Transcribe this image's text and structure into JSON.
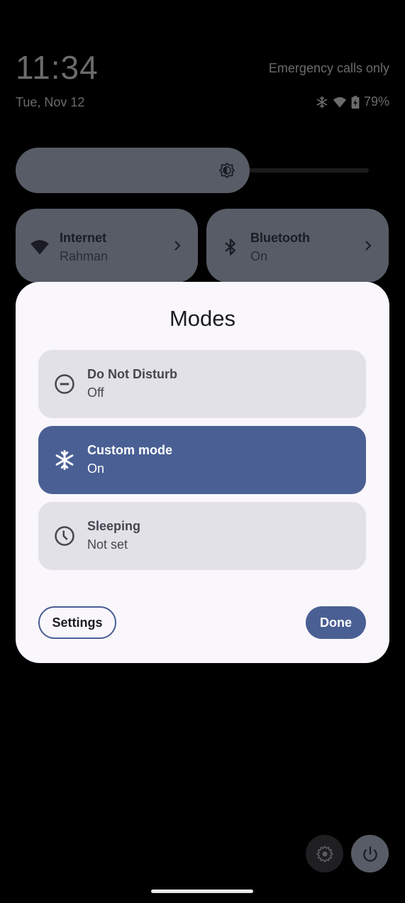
{
  "status_bar": {
    "time": "11:34",
    "date": "Tue, Nov 12",
    "carrier": "Emergency calls only",
    "icons": [
      "snowflake-icon",
      "wifi-icon",
      "battery-charging-icon"
    ],
    "battery": "79%"
  },
  "brightness": {
    "icon": "brightness-icon",
    "level_fraction": 0.66
  },
  "tiles": [
    {
      "title": "Internet",
      "subtitle": "Rahman",
      "icon": "wifi-icon"
    },
    {
      "title": "Bluetooth",
      "subtitle": "On",
      "icon": "bluetooth-icon"
    }
  ],
  "dialog": {
    "title": "Modes",
    "modes": [
      {
        "title": "Do Not Disturb",
        "status": "Off",
        "icon": "do-not-disturb-icon",
        "active": false
      },
      {
        "title": "Custom mode",
        "status": "On",
        "icon": "snowflake-icon",
        "active": true
      },
      {
        "title": "Sleeping",
        "status": "Not set",
        "icon": "clock-icon",
        "active": false
      }
    ],
    "settings_label": "Settings",
    "done_label": "Done"
  },
  "colors": {
    "accent": "#4a5f94",
    "tile_bg": "#585c66",
    "dialog_bg": "#f9f7fc",
    "mode_bg": "#e2e1e8"
  }
}
